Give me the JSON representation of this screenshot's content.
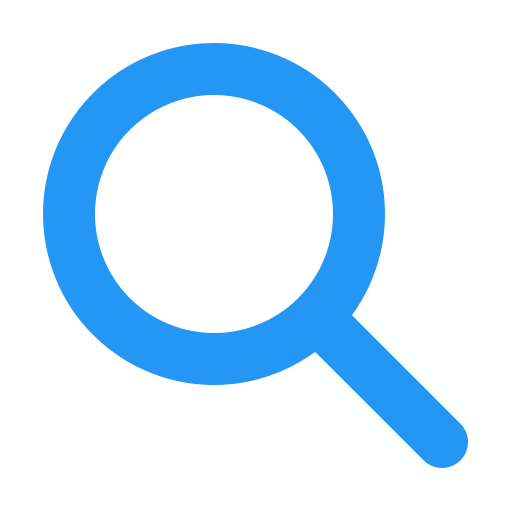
{
  "icon": {
    "name": "search-icon",
    "color": "#2397F3",
    "background": "#FFFFFF"
  }
}
